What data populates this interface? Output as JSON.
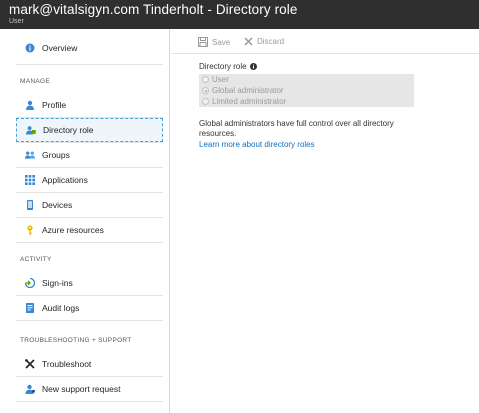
{
  "header": {
    "title": "mark@vitalsigyn.com Tinderholt - Directory role",
    "subtitle": "User"
  },
  "sidebar": {
    "overview": "Overview",
    "sections": {
      "manage": "MANAGE",
      "activity": "ACTIVITY",
      "support": "TROUBLESHOOTING + SUPPORT"
    },
    "manage_items": [
      "Profile",
      "Directory role",
      "Groups",
      "Applications",
      "Devices",
      "Azure resources"
    ],
    "activity_items": [
      "Sign-ins",
      "Audit logs"
    ],
    "support_items": [
      "Troubleshoot",
      "New support request"
    ],
    "selected": "Directory role"
  },
  "toolbar": {
    "save_label": "Save",
    "discard_label": "Discard"
  },
  "form": {
    "field_label": "Directory role",
    "options": [
      "User",
      "Global administrator",
      "Limited administrator"
    ],
    "selected_option": "Global administrator",
    "description": "Global administrators have full control over all directory resources.",
    "link_text": "Learn more about directory roles"
  },
  "colors": {
    "header_bg": "#2f2f2f",
    "link": "#1270c4",
    "selection_border": "#4aa0d8"
  }
}
